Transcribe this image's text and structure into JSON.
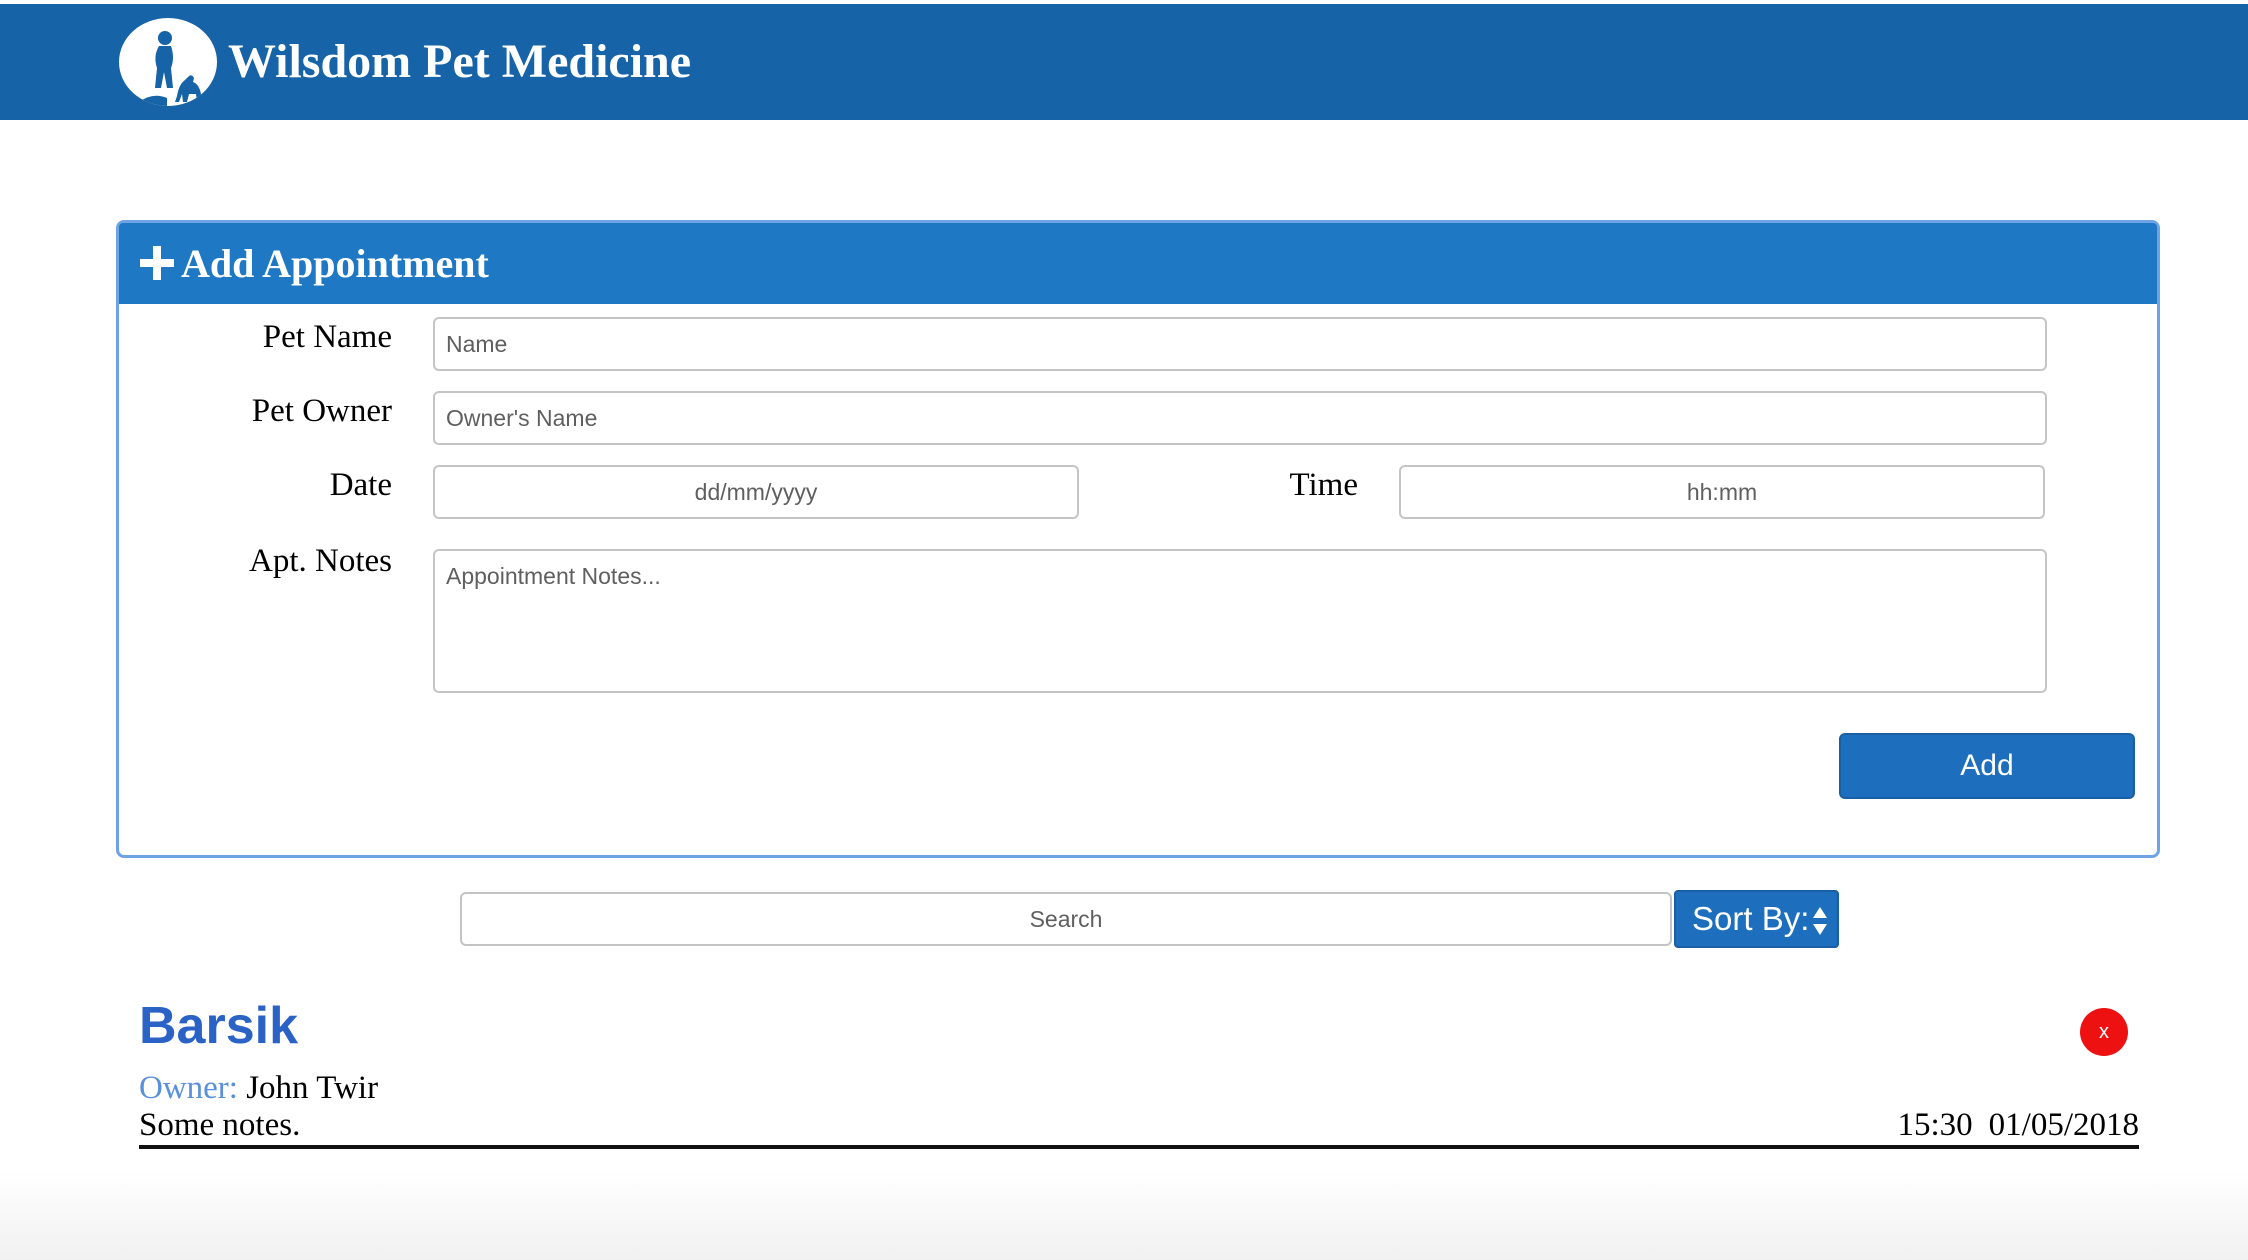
{
  "header": {
    "app_title": "Wilsdom Pet Medicine",
    "logo_icon": "pet-owner-silhouette-icon",
    "bg_color": "#1763a7"
  },
  "add_form": {
    "title": "Add Appointment",
    "title_icon": "plus-icon",
    "pet_name_label": "Pet Name",
    "pet_name_placeholder": "Name",
    "pet_owner_label": "Pet Owner",
    "pet_owner_placeholder": "Owner's Name",
    "date_label": "Date",
    "date_placeholder": "dd/mm/yyyy",
    "time_label": "Time",
    "time_placeholder": "hh:mm",
    "notes_label": "Apt. Notes",
    "notes_placeholder": "Appointment Notes...",
    "add_label": "Add",
    "accent_color": "#1e78c4"
  },
  "search": {
    "placeholder": "Search",
    "sort_label": "Sort By:",
    "sort_icon": "sort-arrows-icon"
  },
  "appointments": [
    {
      "pet_name": "Barsik",
      "owner_label": "Owner:",
      "owner": "John Twir",
      "notes": "Some notes.",
      "time": "15:30",
      "date": "01/05/2018",
      "delete_label": "x",
      "delete_color": "#ee1111"
    }
  ]
}
